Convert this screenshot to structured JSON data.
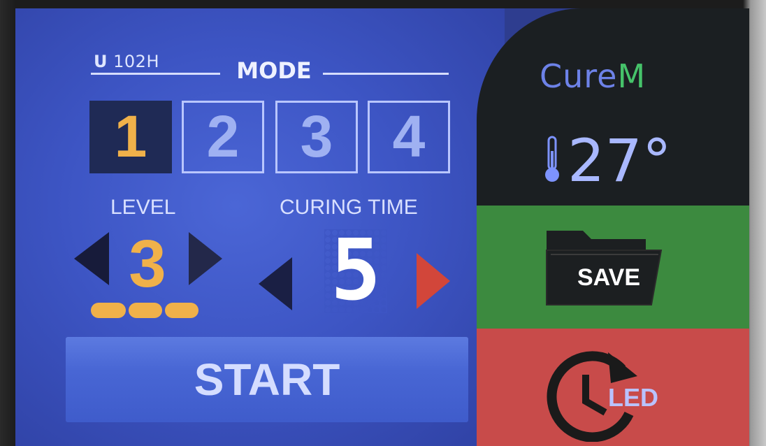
{
  "model": {
    "prefix": "U",
    "number": "102H"
  },
  "mode": {
    "title": "MODE",
    "options": [
      "1",
      "2",
      "3",
      "4"
    ],
    "selected": "1"
  },
  "level": {
    "label": "LEVEL",
    "value": "3",
    "bar_segments": 3
  },
  "curing_time": {
    "label": "CURING TIME",
    "value": "5"
  },
  "start_button": {
    "label": "START"
  },
  "brand": {
    "part1": "Cure",
    "part2": "M"
  },
  "temperature": {
    "value": "27°",
    "icon": "thermometer-icon"
  },
  "save_button": {
    "label": "SAVE",
    "icon": "folder-icon"
  },
  "led_button": {
    "label": "LED",
    "icon": "clock-refresh-icon"
  },
  "colors": {
    "panel_blue": "#3d55c4",
    "accent_orange": "#f0b14a",
    "save_green": "#3c8a3f",
    "led_red": "#c84b4a",
    "brand_green": "#46c36a"
  }
}
